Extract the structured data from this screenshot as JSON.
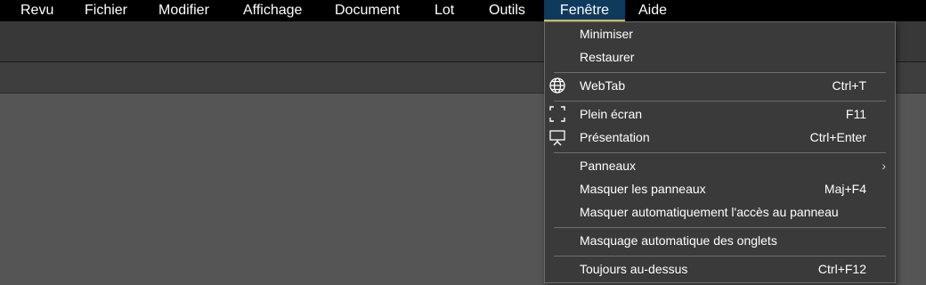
{
  "menubar": {
    "items": [
      {
        "label": "Revu"
      },
      {
        "label": "Fichier"
      },
      {
        "label": "Modifier"
      },
      {
        "label": "Affichage"
      },
      {
        "label": "Document"
      },
      {
        "label": "Lot"
      },
      {
        "label": "Outils"
      },
      {
        "label": "Fenêtre"
      },
      {
        "label": "Aide"
      }
    ],
    "active": "Fenêtre"
  },
  "window_menu": {
    "items": [
      {
        "label": "Minimiser",
        "shortcut": "",
        "icon": ""
      },
      {
        "label": "Restaurer",
        "shortcut": "",
        "icon": ""
      },
      {
        "label": "WebTab",
        "shortcut": "Ctrl+T",
        "icon": "globe-icon"
      },
      {
        "label": "Plein écran",
        "shortcut": "F11",
        "icon": "fullscreen-icon"
      },
      {
        "label": "Présentation",
        "shortcut": "Ctrl+Enter",
        "icon": "presentation-icon"
      },
      {
        "label": "Panneaux",
        "shortcut": "",
        "icon": "",
        "submenu": "›"
      },
      {
        "label": "Masquer les panneaux",
        "shortcut": "Maj+F4",
        "icon": ""
      },
      {
        "label": "Masquer automatiquement l'accès au panneau",
        "shortcut": "",
        "icon": ""
      },
      {
        "label": "Masquage automatique des onglets",
        "shortcut": "",
        "icon": ""
      },
      {
        "label": "Toujours au-dessus",
        "shortcut": "Ctrl+F12",
        "icon": ""
      }
    ]
  },
  "colors": {
    "menubar_bg": "#000000",
    "active_menu_bg": "#0f3a5c",
    "active_menu_underline": "#d7c36a",
    "dropdown_bg": "#3a3a3a",
    "workspace_bg": "#555555"
  }
}
